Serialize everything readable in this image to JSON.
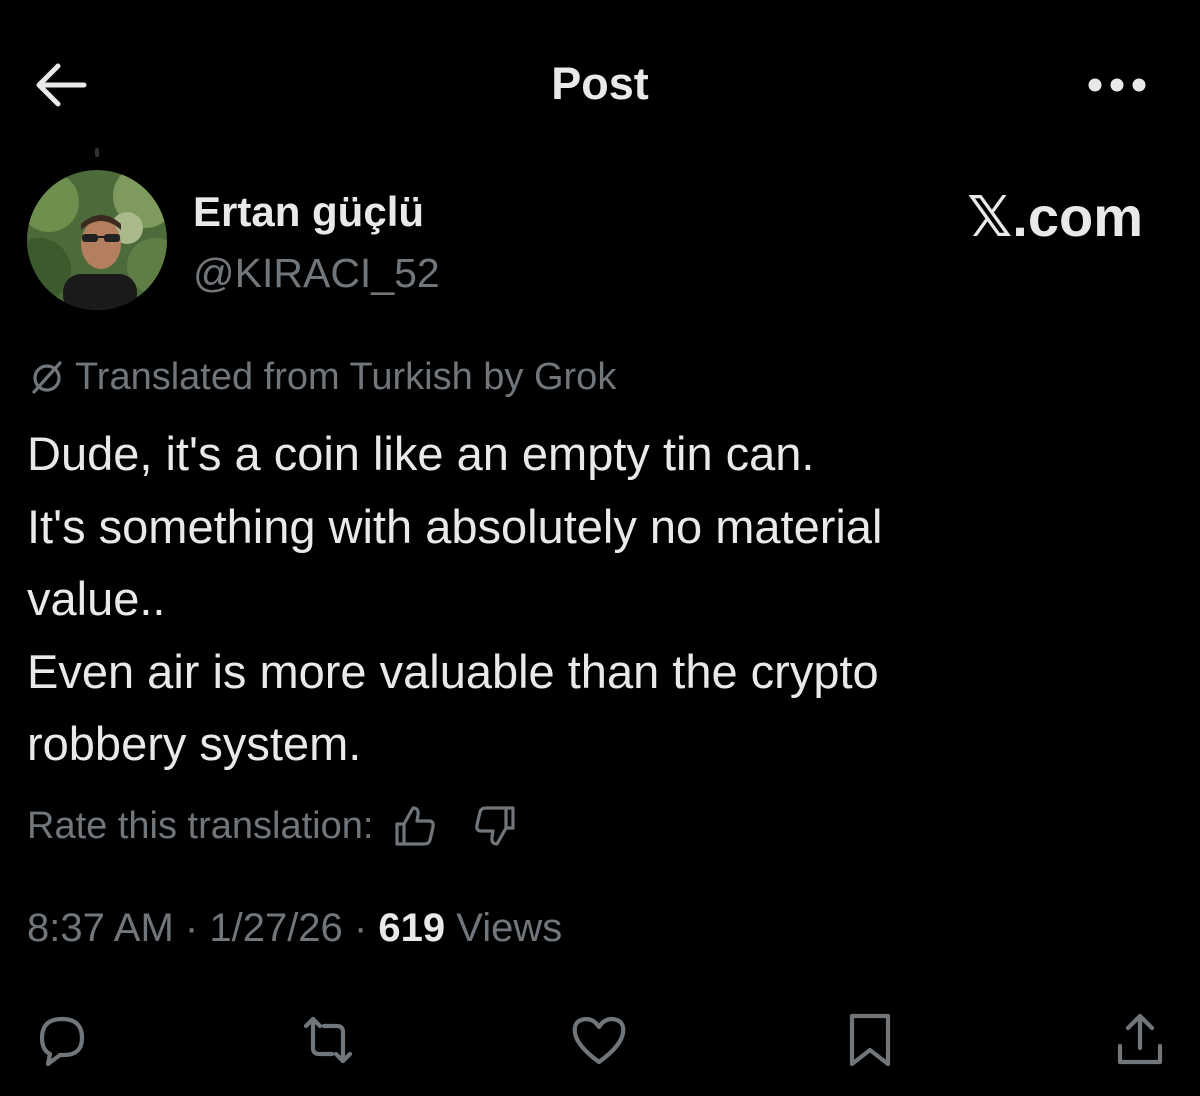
{
  "header": {
    "title": "Post",
    "back_icon": "arrow-left-icon",
    "more_icon": "more-horizontal-icon"
  },
  "post": {
    "author": {
      "name": "Ertan güçlü",
      "handle": "@KIRACI_52"
    },
    "brand": "𝕏.com",
    "translation_note": "Translated from Turkish by Grok",
    "text_lines": [
      "Dude, it's a coin like an empty tin can.",
      "It's something with absolutely no material",
      "value..",
      "Even air is more valuable than the crypto",
      "robbery system."
    ],
    "rate_translation_label": "Rate this translation:",
    "time": "8:37 AM",
    "date": "1/27/26",
    "separator": "·",
    "views_count": "619",
    "views_label": "Views"
  },
  "actions": {
    "reply": "reply-icon",
    "repost": "repost-icon",
    "like": "like-icon",
    "bookmark": "bookmark-icon",
    "share": "share-icon"
  },
  "colors": {
    "background": "#000000",
    "primary_text": "#e7e9ea",
    "secondary_text": "#71767b"
  }
}
